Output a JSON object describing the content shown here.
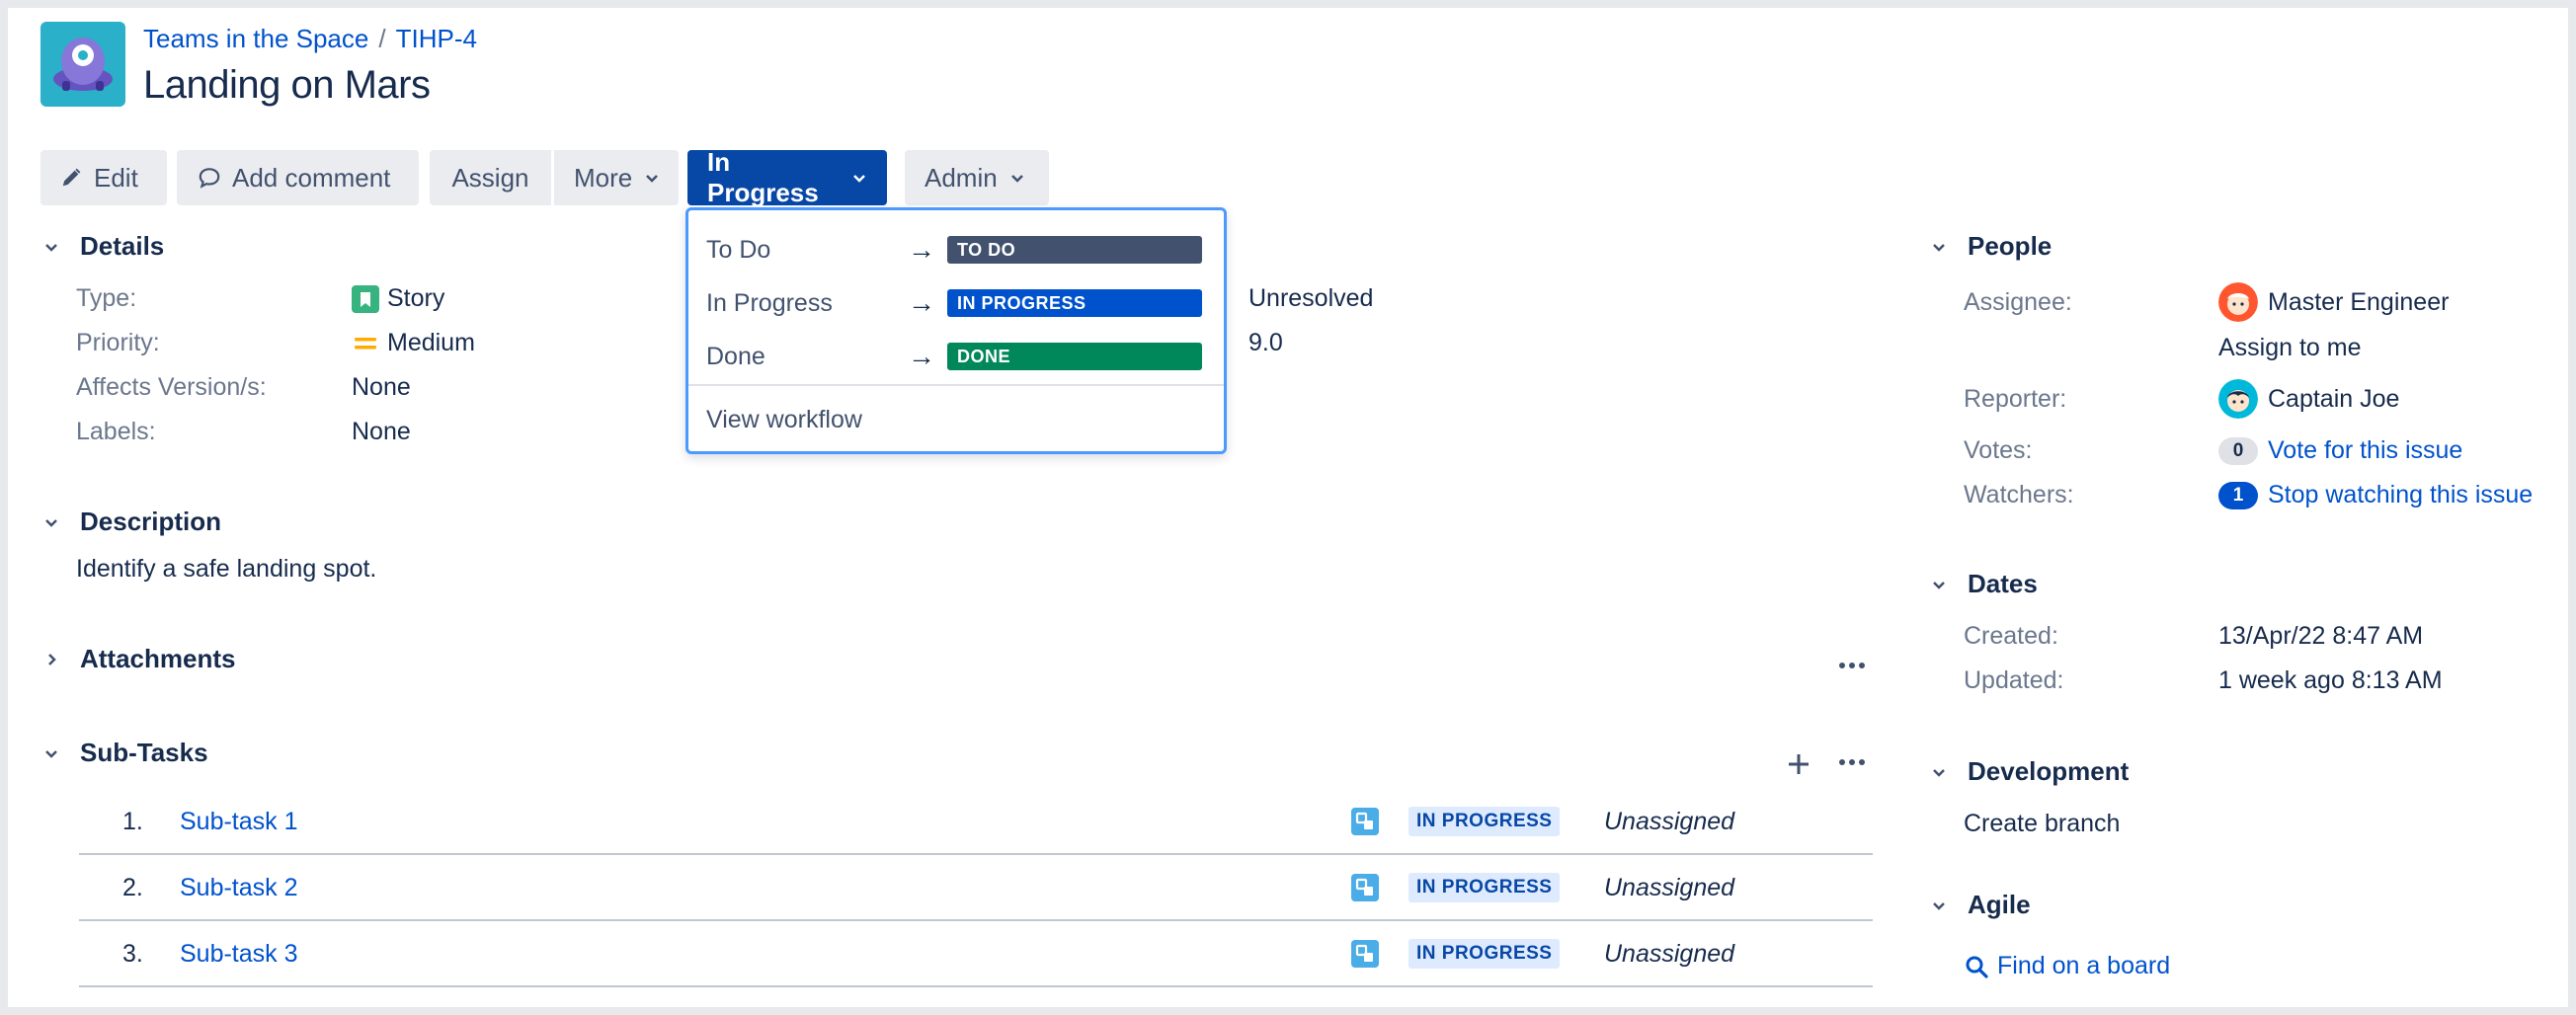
{
  "breadcrumb": {
    "project": "Teams in the Space",
    "separator": "/",
    "issue_key": "TIHP-4"
  },
  "issue": {
    "title": "Landing on Mars"
  },
  "toolbar": {
    "edit": "Edit",
    "add_comment": "Add comment",
    "assign": "Assign",
    "more": "More",
    "status": "In Progress",
    "admin": "Admin"
  },
  "status_menu": {
    "items": [
      {
        "label": "To Do",
        "arrow": "→",
        "status": "TO DO",
        "color": "#42526e"
      },
      {
        "label": "In Progress",
        "arrow": "→",
        "status": "IN PROGRESS",
        "color": "#0052cc"
      },
      {
        "label": "Done",
        "arrow": "→",
        "status": "DONE",
        "color": "#00875a"
      }
    ],
    "view_workflow": "View workflow"
  },
  "details": {
    "heading": "Details",
    "type_label": "Type:",
    "type_value": "Story",
    "priority_label": "Priority:",
    "priority_value": "Medium",
    "affects_label": "Affects Version/s:",
    "affects_value": "None",
    "labels_label": "Labels:",
    "labels_value": "None",
    "resolution_value": "Unresolved",
    "fix_version_value": "9.0"
  },
  "description": {
    "heading": "Description",
    "text": "Identify a safe landing spot."
  },
  "attachments": {
    "heading": "Attachments"
  },
  "subtasks": {
    "heading": "Sub-Tasks",
    "rows": [
      {
        "num": "1.",
        "name": "Sub-task 1",
        "status": "IN PROGRESS",
        "assignee": "Unassigned"
      },
      {
        "num": "2.",
        "name": "Sub-task 2",
        "status": "IN PROGRESS",
        "assignee": "Unassigned"
      },
      {
        "num": "3.",
        "name": "Sub-task 3",
        "status": "IN PROGRESS",
        "assignee": "Unassigned"
      }
    ]
  },
  "people": {
    "heading": "People",
    "assignee_label": "Assignee:",
    "assignee_value": "Master Engineer",
    "assign_to_me": "Assign to me",
    "reporter_label": "Reporter:",
    "reporter_value": "Captain Joe",
    "votes_label": "Votes:",
    "votes_count": "0",
    "vote_link": "Vote for this issue",
    "watchers_label": "Watchers:",
    "watchers_count": "1",
    "watch_link": "Stop watching this issue"
  },
  "dates": {
    "heading": "Dates",
    "created_label": "Created:",
    "created_value": "13/Apr/22 8:47 AM",
    "updated_label": "Updated:",
    "updated_value": "1 week ago 8:13 AM"
  },
  "development": {
    "heading": "Development",
    "create_branch": "Create branch"
  },
  "agile": {
    "heading": "Agile",
    "find_on_board": "Find on a board"
  },
  "colors": {
    "primary": "#0747a6",
    "link": "#0052cc",
    "button_bg": "#ebecf0",
    "focus_border": "#4c9aff"
  }
}
